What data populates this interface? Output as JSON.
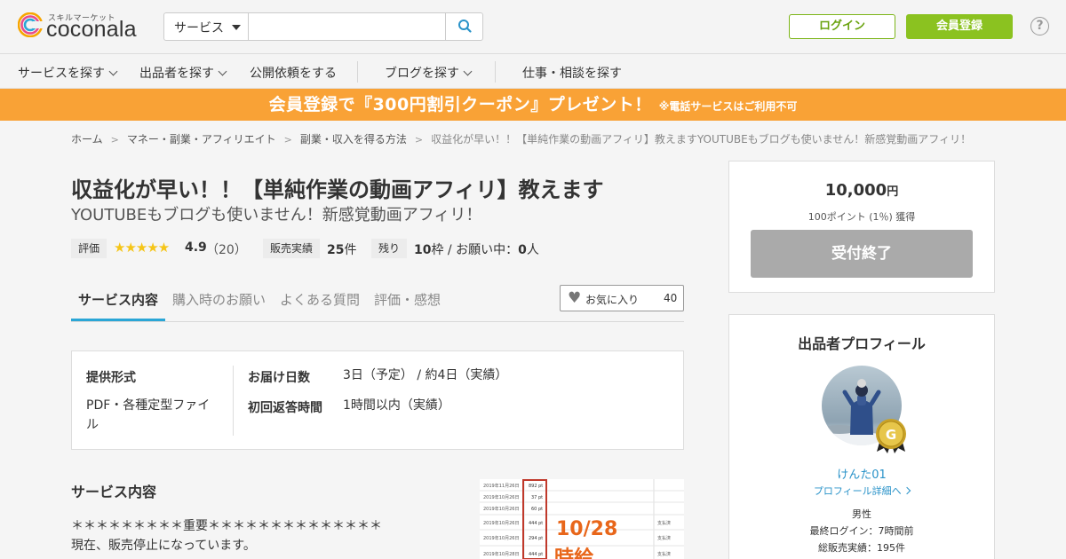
{
  "header": {
    "logo_tagline": "スキルマーケット",
    "logo_wordmark": "coconala",
    "search": {
      "category": "サービス",
      "placeholder": "",
      "value": ""
    },
    "login_label": "ログイン",
    "signup_label": "会員登録",
    "help_label": "?"
  },
  "nav": {
    "items": [
      {
        "label": "サービスを探す"
      },
      {
        "label": "出品者を探す"
      },
      {
        "label": "公開依頼をする"
      },
      {
        "label": "ブログを探す"
      },
      {
        "label": "仕事・相談を探す"
      }
    ]
  },
  "banner": {
    "main": "会員登録で『300円割引クーポン』プレゼント！",
    "note": "※電話サービスはご利用不可",
    "color": "#f9a236"
  },
  "breadcrumb": {
    "items": [
      "ホーム",
      "マネー・副業・アフィリエイト",
      "副業・収入を得る方法"
    ],
    "current": "収益化が早い！！【単純作業の動画アフィリ】教えますYOUTUBEもブログも使いません！新感覚動画アフィリ！",
    "separator": ">"
  },
  "service": {
    "title": "収益化が早い！！【単純作業の動画アフィリ】教えます",
    "subtitle": "YOUTUBEもブログも使いません！新感覚動画アフィリ！",
    "rating_label": "評価",
    "rating_stars": "★★★★★",
    "rating_value": "4.9",
    "rating_count": "（20）",
    "sales_label": "販売実績",
    "sales_value": "25",
    "sales_unit": "件",
    "remaining_label": "残り",
    "remaining_value": "10",
    "remaining_text": "枠 / お願い中：",
    "requests_value": "0",
    "requests_unit": "人"
  },
  "tabs": [
    {
      "label": "サービス内容",
      "active": true
    },
    {
      "label": "購入時のお願い",
      "active": false
    },
    {
      "label": "よくある質問",
      "active": false
    },
    {
      "label": "評価・感想",
      "active": false
    }
  ],
  "favorite": {
    "label": "お気に入り",
    "count": "40"
  },
  "info": {
    "format_label": "提供形式",
    "format_value": "PDF・各種定型ファイル",
    "delivery_label": "お届け日数",
    "delivery_value": "3日（予定） / 約4日（実績）",
    "reply_label": "初回返答時間",
    "reply_value": "1時間以内（実績）"
  },
  "description": {
    "heading": "サービス内容",
    "lines": [
      "＊＊＊＊＊＊＊＊＊重要＊＊＊＊＊＊＊＊＊＊＊＊＊＊",
      "現在、販売停止になっています。"
    ]
  },
  "thumbnail": {
    "dates": [
      "2019年11月26日",
      "2019年10月26日",
      "2019年10月26日",
      "2019年10月26日",
      "2019年10月26日",
      "2019年10月28日"
    ],
    "points": [
      "892 pt",
      "37 pt",
      "60 pt",
      "444 pt",
      "294 pt",
      "444 pt"
    ],
    "overlay": "10/28",
    "overlay2": "時給",
    "status": [
      "支払済",
      "支払済",
      "支払済"
    ]
  },
  "pricing": {
    "price": "10,000",
    "currency": "円",
    "points_note": "100ポイント (1％) 獲得",
    "button": "受付終了"
  },
  "profile": {
    "heading": "出品者プロフィール",
    "badge_letter": "G",
    "name": "けんた01",
    "link": "プロフィール詳細へ",
    "gender": "男性",
    "last_login": "最終ログイン：7時間前",
    "total_sales": "総販売実績：195件"
  },
  "colors": {
    "brand_green": "#8bc220",
    "link_blue": "#2a93c9",
    "tab_accent": "#2aa6d6",
    "star": "#f5c518"
  }
}
